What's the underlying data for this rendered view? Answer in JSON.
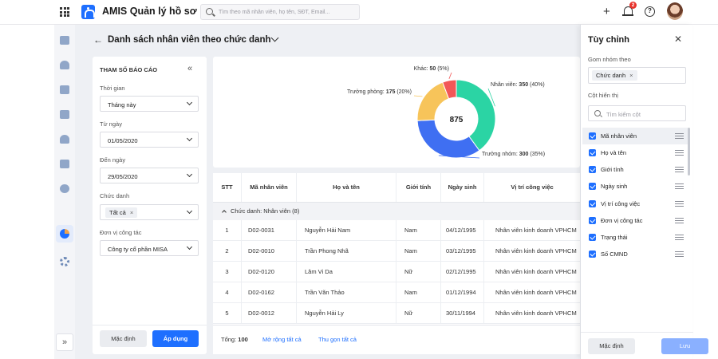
{
  "app": {
    "title": "AMIS Quản lý hồ sơ"
  },
  "search": {
    "placeholder": "Tìm theo mã nhân viên, họ tên, SĐT, Email..."
  },
  "header": {
    "notification_count": "2",
    "help_glyph": "?"
  },
  "page": {
    "title": "Danh sách nhân viên theo chức danh"
  },
  "params": {
    "header": "THAM SỐ BÁO CÁO",
    "period_label": "Thời gian",
    "period_value": "Tháng này",
    "from_label": "Từ ngày",
    "from_value": "01/05/2020",
    "to_label": "Đến ngày",
    "to_value": "29/05/2020",
    "title_label": "Chức danh",
    "title_value": "Tất cả",
    "unit_label": "Đơn vị công tác",
    "unit_value": "Công ty cổ phần MISA",
    "default_btn": "Mặc định",
    "apply_btn": "Áp dụng"
  },
  "chart_data": {
    "type": "pie",
    "variant": "donut",
    "center_label": "875",
    "slices": [
      {
        "label": "Nhân viên",
        "value": 350,
        "pct": "40%",
        "color": "#2bd4a4"
      },
      {
        "label": "Trưởng nhóm",
        "value": 300,
        "pct": "35%",
        "color": "#3f6ff2"
      },
      {
        "label": "Trưởng phòng",
        "value": 175,
        "pct": "20%",
        "color": "#f7c45a"
      },
      {
        "label": "Khác",
        "value": 50,
        "pct": "5%",
        "color": "#f25757"
      }
    ]
  },
  "table": {
    "columns": [
      "STT",
      "Mã nhân viên",
      "Họ và tên",
      "Giới tính",
      "Ngày sinh",
      "Vị trí công việc"
    ],
    "group_label": "Chức danh: Nhân viên (8)",
    "rows": [
      {
        "stt": "1",
        "code": "D02-0031",
        "name": "Nguyễn Hải Nam",
        "gender": "Nam",
        "dob": "04/12/1995",
        "position": "Nhân viên kinh doanh VPHCM"
      },
      {
        "stt": "2",
        "code": "D02-0010",
        "name": "Trần Phong Nhã",
        "gender": "Nam",
        "dob": "03/12/1995",
        "position": "Nhân viên kinh doanh VPHCM"
      },
      {
        "stt": "3",
        "code": "D02-0120",
        "name": "Lâm Vi Da",
        "gender": "Nữ",
        "dob": "02/12/1995",
        "position": "Nhân viên kinh doanh VPHCM"
      },
      {
        "stt": "4",
        "code": "D02-0162",
        "name": "Trần Văn Thảo",
        "gender": "Nam",
        "dob": "01/12/1994",
        "position": "Nhân viên kinh doanh VPHCM"
      },
      {
        "stt": "5",
        "code": "D02-0012",
        "name": "Nguyễn Hải Ly",
        "gender": "Nữ",
        "dob": "30/11/1994",
        "position": "Nhân viên kinh doanh VPHCM"
      }
    ],
    "total_label": "Tổng:",
    "total_value": "100",
    "expand_all": "Mở rộng tất cả",
    "collapse_all": "Thu gọn tất cả"
  },
  "customize": {
    "title": "Tùy chỉnh",
    "group_by_label": "Gom nhóm theo",
    "group_by_value": "Chức danh",
    "columns_label": "Cột hiển thị",
    "search_placeholder": "Tìm kiếm cột",
    "items": [
      "Mã nhân viên",
      "Họ và tên",
      "Giới tính",
      "Ngày sinh",
      "Vị trí công việc",
      "Đơn vị công tác",
      "Trạng thái",
      "Số CMND"
    ],
    "default_btn": "Mặc định",
    "save_btn": "Lưu"
  },
  "colors": {
    "accent": "#1e6fff",
    "save_disabled": "#8ab0ff"
  }
}
